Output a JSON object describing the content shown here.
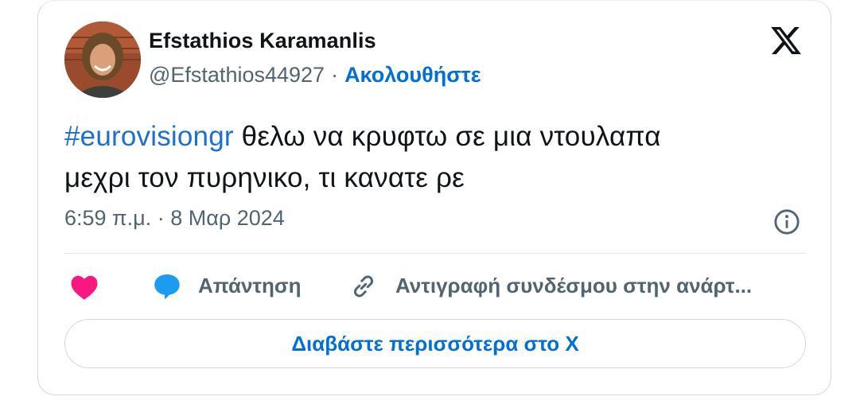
{
  "author": {
    "name": "Efstathios Karamanlis",
    "handle": "@Efstathios44927",
    "separator": "·",
    "follow_label": "Ακολουθήστε"
  },
  "tweet": {
    "hashtag": "#eurovisiongr",
    "text_line1": " θελω να κρυφτω σε μια ντουλαπα",
    "text_line2": "μεχρι τον πυρηνικο, τι κανατε ρε",
    "timestamp": "6:59 π.μ. · 8 Μαρ 2024"
  },
  "actions": {
    "reply_label": "Απάντηση",
    "copy_link_label": "Αντιγραφή συνδέσμου στην ανάρτ..."
  },
  "read_more_label": "Διαβάστε περισσότερα στο X",
  "icons": {
    "brand": "x-logo-icon",
    "info": "info-icon",
    "like": "heart-icon",
    "reply": "reply-bubble-icon",
    "copy": "link-icon"
  },
  "colors": {
    "link_blue": "#006fd6",
    "heart_pink": "#f91880",
    "reply_blue": "#1d9bf0",
    "muted_text": "#536471",
    "border": "#cfd9de"
  }
}
